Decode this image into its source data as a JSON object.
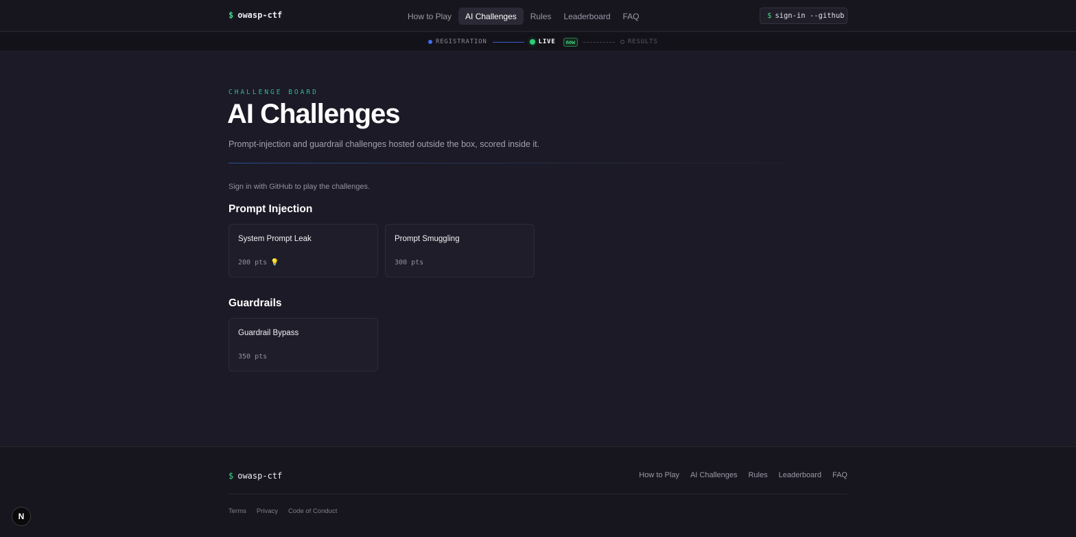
{
  "header": {
    "brand_symbol": "$",
    "brand_name": "owasp-ctf",
    "nav": [
      {
        "label": "How to Play",
        "active": false
      },
      {
        "label": "AI Challenges",
        "active": true
      },
      {
        "label": "Rules",
        "active": false
      },
      {
        "label": "Leaderboard",
        "active": false
      },
      {
        "label": "FAQ",
        "active": false
      }
    ],
    "signin_symbol": "$",
    "signin_label": "sign-in --github"
  },
  "phases": {
    "registration": "REGISTRATION",
    "live": "LIVE",
    "now_badge": "now",
    "results": "RESULTS"
  },
  "hero": {
    "eyebrow": "CHALLENGE BOARD",
    "title": "AI Challenges",
    "subtitle": "Prompt-injection and guardrail challenges hosted outside the box, scored inside it.",
    "signin_note": "Sign in with GitHub to play the challenges."
  },
  "sections": [
    {
      "title": "Prompt Injection",
      "cards": [
        {
          "title": "System Prompt Leak",
          "points": "200 pts",
          "hint_icon": "lightbulb-icon"
        },
        {
          "title": "Prompt Smuggling",
          "points": "300 pts"
        }
      ]
    },
    {
      "title": "Guardrails",
      "cards": [
        {
          "title": "Guardrail Bypass",
          "points": "350 pts"
        }
      ]
    }
  ],
  "footer": {
    "brand_symbol": "$",
    "brand_name": "owasp-ctf",
    "links": [
      "How to Play",
      "AI Challenges",
      "Rules",
      "Leaderboard",
      "FAQ"
    ],
    "legal": [
      "Terms",
      "Privacy",
      "Code of Conduct"
    ]
  },
  "dev_badge": "N",
  "colors": {
    "background": "#1b1a26",
    "accent_green": "#3ddc84",
    "accent_teal": "#2fb89a",
    "accent_blue": "#3d6ff0"
  }
}
